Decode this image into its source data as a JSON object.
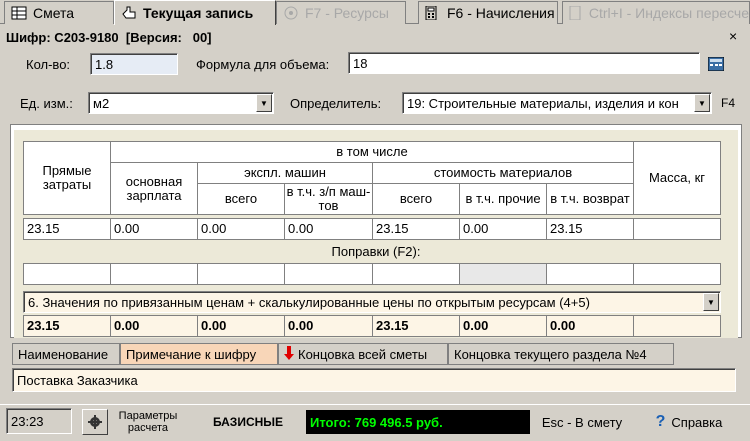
{
  "top_tabs": [
    {
      "label": "Смета",
      "state": "normal"
    },
    {
      "label": "Текущая запись",
      "state": "active"
    },
    {
      "label": "F7 - Ресурсы",
      "state": "disabled"
    },
    {
      "label": "F6 - Начисления",
      "state": "normal"
    },
    {
      "label": "Ctrl+I - Индексы пересче",
      "state": "disabled"
    }
  ],
  "record": {
    "cipher_line": "Шифр: С203-9180  [Версия:   00]",
    "qty_label": "Кол-во:",
    "qty_value": "1.8",
    "formula_label": "Формула для объема:",
    "formula_value": "18",
    "unit_label": "Ед. изм.:",
    "unit_value": "м2",
    "determinant_label": "Определитель:",
    "determinant_value": "19: Строительные материалы, изделия и кон",
    "f4": "F4",
    "close": "×"
  },
  "table": {
    "h_direct": "Прямые затраты",
    "h_incl": "в том числе",
    "h_base_salary": "основная зарплата",
    "h_machines": "экспл. машин",
    "h_machines_total": "всего",
    "h_machines_wage": "в т.ч. з/п маш-тов",
    "h_materials": "стоимость материалов",
    "h_materials_total": "всего",
    "h_materials_other": "в т.ч. прочие",
    "h_materials_return": "в т.ч. возврат",
    "h_mass": "Масса, кг",
    "row1": [
      "23.15",
      "0.00",
      "0.00",
      "0.00",
      "23.15",
      "0.00",
      "23.15",
      ""
    ],
    "corrections_label": "Поправки (F2):",
    "mode_value": "6. Значения по привязанным ценам + скалькулированные цены по открытым ресурсам (4+5)",
    "row_total": [
      "23.15",
      "0.00",
      "0.00",
      "0.00",
      "23.15",
      "0.00",
      "0.00",
      ""
    ]
  },
  "bottom_tabs": [
    {
      "label": "Наименование"
    },
    {
      "label": "Примечание к шифру"
    },
    {
      "label": "Концовка всей сметы"
    },
    {
      "label": "Концовка текущего раздела №4"
    }
  ],
  "note_value": "Поставка Заказчика",
  "status": {
    "time": "23:23",
    "params_label": "Параметры расчета",
    "basis": "БАЗИСНЫЕ",
    "total": "Итого: 769 496.5 руб.",
    "esc": "Esc - В смету",
    "help": "Справка"
  },
  "colors": {
    "accent_tab": "#f8d6b8",
    "total_text": "#00ff00",
    "total_bg": "#000000"
  }
}
